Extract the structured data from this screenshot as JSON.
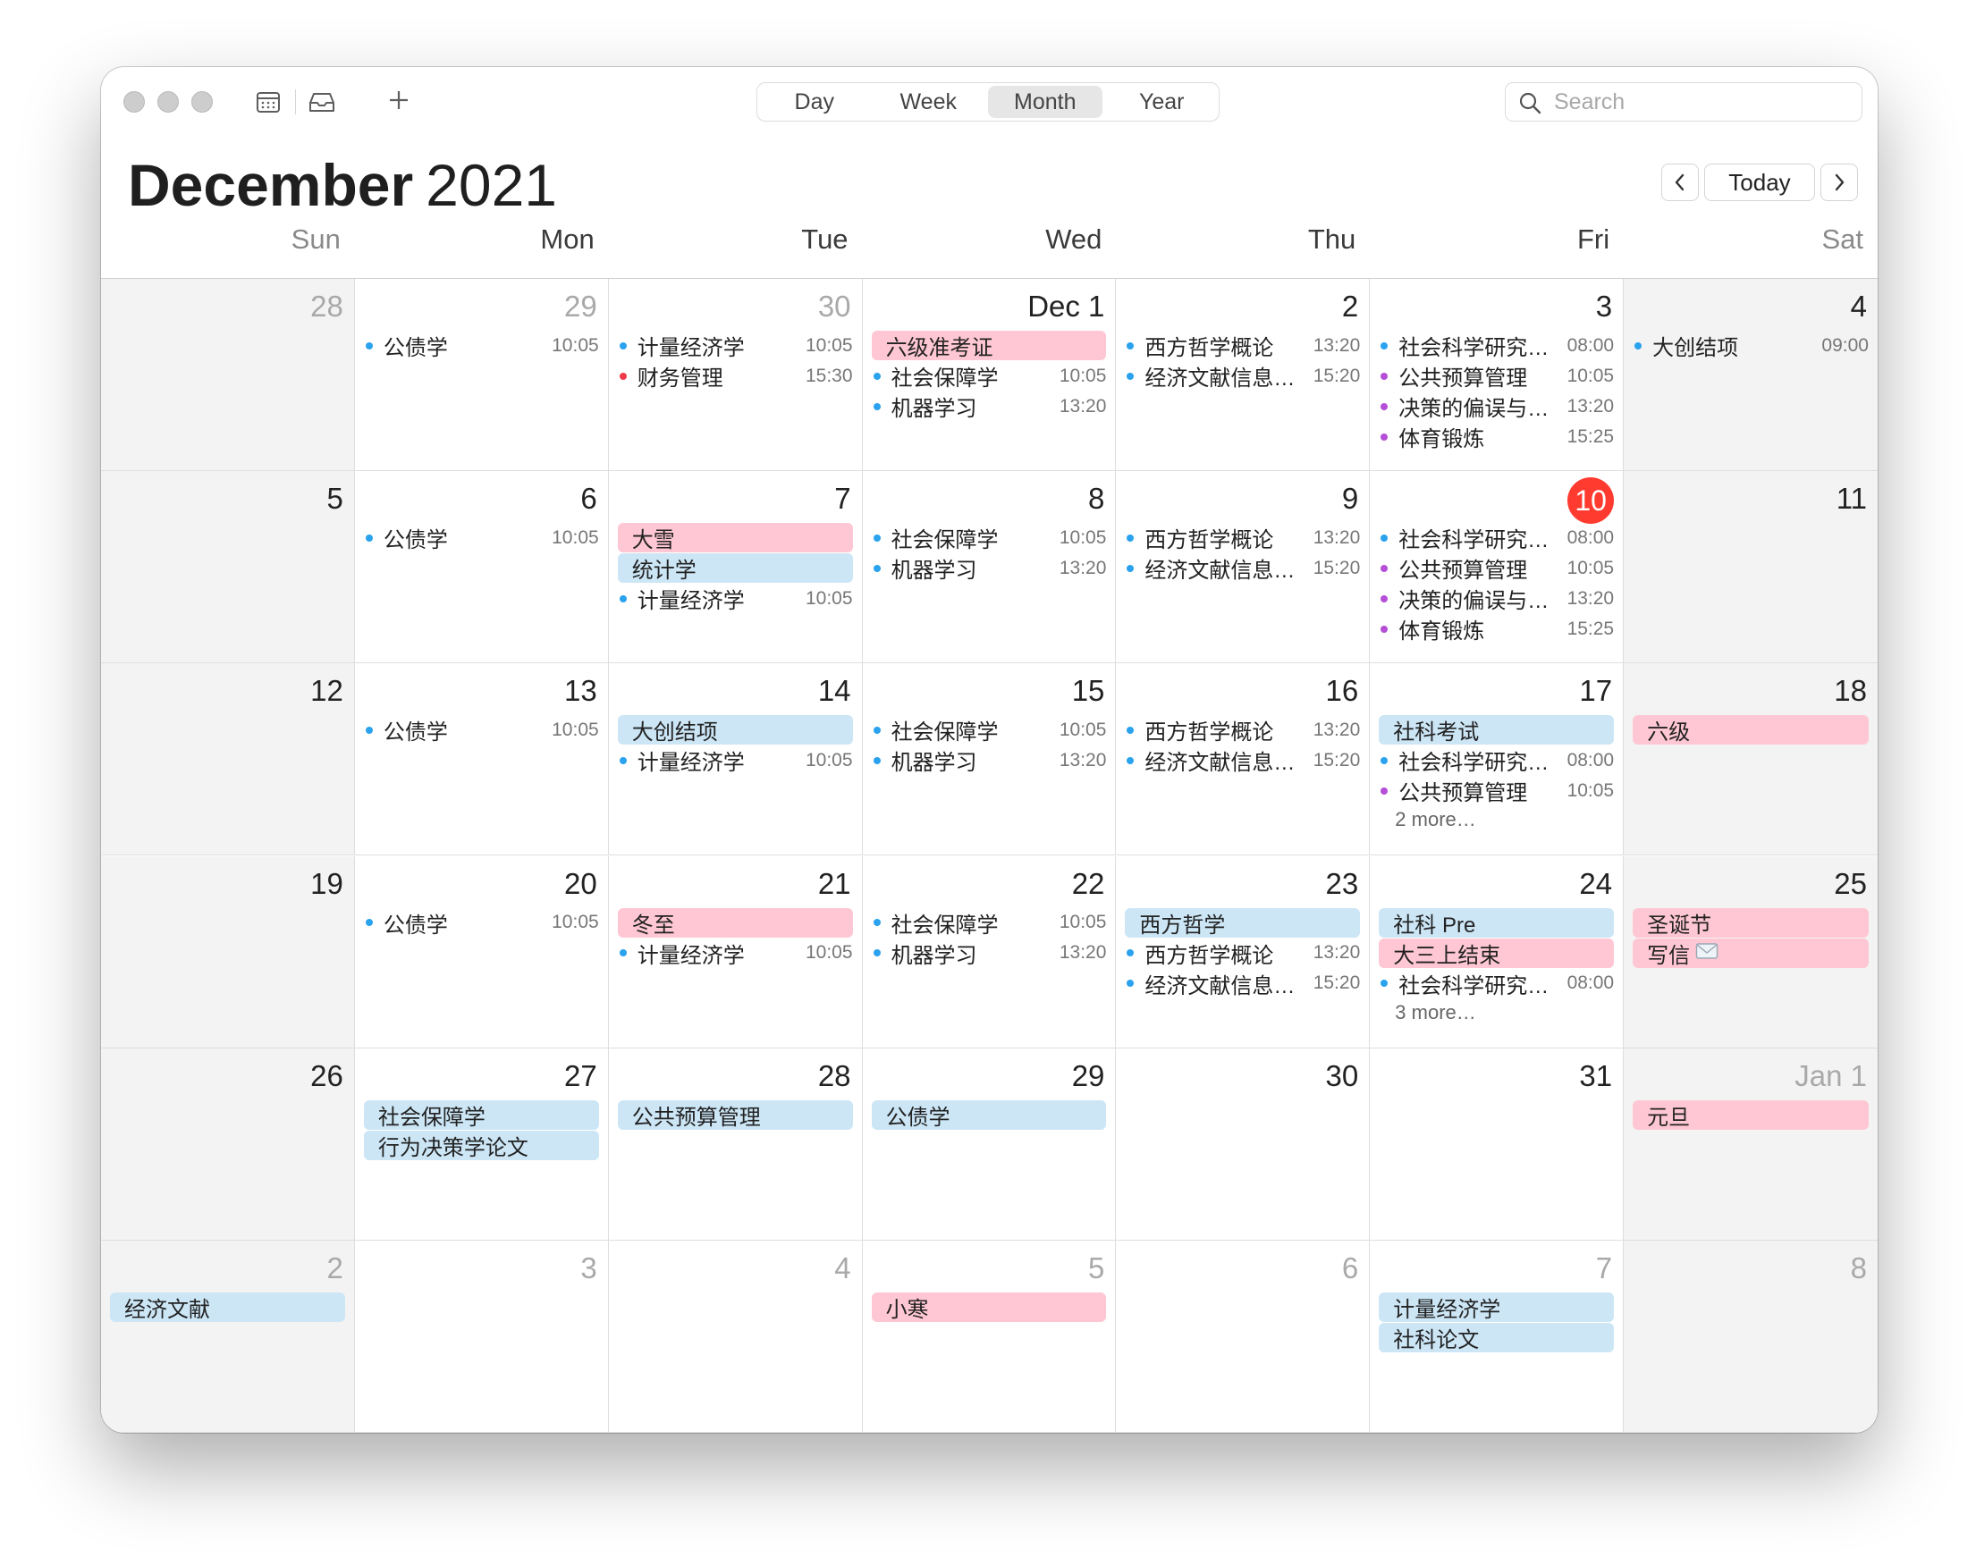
{
  "colors": {
    "blue_dot": "#2aa2ee",
    "red_dot": "#f03a4a",
    "purple_dot": "#b54fd7",
    "allday_pink": "#ffc7d4",
    "allday_blue": "#cce6f6",
    "today_red": "#ff3b30"
  },
  "toolbar": {
    "views": [
      "Day",
      "Week",
      "Month",
      "Year"
    ],
    "active_view": "Month",
    "search_placeholder": "Search",
    "icons": [
      "calendar-list-icon",
      "inbox-icon",
      "plus-icon",
      "search-icon"
    ]
  },
  "header": {
    "month": "December",
    "year": "2021",
    "today_label": "Today"
  },
  "weekdays": [
    "Sun",
    "Mon",
    "Tue",
    "Wed",
    "Thu",
    "Fri",
    "Sat"
  ],
  "weeks": [
    [
      {
        "label": "28",
        "muted": true,
        "events": []
      },
      {
        "label": "29",
        "muted": true,
        "events": [
          {
            "name": "公债学",
            "time": "10:05",
            "dot": "blue"
          }
        ]
      },
      {
        "label": "30",
        "muted": true,
        "events": [
          {
            "name": "计量经济学",
            "time": "10:05",
            "dot": "blue"
          },
          {
            "name": "财务管理",
            "time": "15:30",
            "dot": "red"
          }
        ]
      },
      {
        "label": "Dec 1",
        "events": [
          {
            "name": "六级准考证",
            "allday": "pink"
          },
          {
            "name": "社会保障学",
            "time": "10:05",
            "dot": "blue"
          },
          {
            "name": "机器学习",
            "time": "13:20",
            "dot": "blue"
          }
        ]
      },
      {
        "label": "2",
        "events": [
          {
            "name": "西方哲学概论",
            "time": "13:20",
            "dot": "blue"
          },
          {
            "name": "经济文献信息…",
            "time": "15:20",
            "dot": "blue"
          }
        ]
      },
      {
        "label": "3",
        "events": [
          {
            "name": "社会科学研究…",
            "time": "08:00",
            "dot": "blue"
          },
          {
            "name": "公共预算管理",
            "time": "10:05",
            "dot": "purple"
          },
          {
            "name": "决策的偏误与…",
            "time": "13:20",
            "dot": "purple"
          },
          {
            "name": "体育锻炼",
            "time": "15:25",
            "dot": "purple"
          }
        ]
      },
      {
        "label": "4",
        "events": [
          {
            "name": "大创结项",
            "time": "09:00",
            "dot": "blue"
          }
        ]
      }
    ],
    [
      {
        "label": "5",
        "events": []
      },
      {
        "label": "6",
        "events": [
          {
            "name": "公债学",
            "time": "10:05",
            "dot": "blue"
          }
        ]
      },
      {
        "label": "7",
        "events": [
          {
            "name": "大雪",
            "allday": "pink"
          },
          {
            "name": "统计学",
            "allday": "blue"
          },
          {
            "name": "计量经济学",
            "time": "10:05",
            "dot": "blue"
          }
        ]
      },
      {
        "label": "8",
        "events": [
          {
            "name": "社会保障学",
            "time": "10:05",
            "dot": "blue"
          },
          {
            "name": "机器学习",
            "time": "13:20",
            "dot": "blue"
          }
        ]
      },
      {
        "label": "9",
        "events": [
          {
            "name": "西方哲学概论",
            "time": "13:20",
            "dot": "blue"
          },
          {
            "name": "经济文献信息…",
            "time": "15:20",
            "dot": "blue"
          }
        ]
      },
      {
        "label": "10",
        "today": true,
        "events": [
          {
            "name": "社会科学研究…",
            "time": "08:00",
            "dot": "blue"
          },
          {
            "name": "公共预算管理",
            "time": "10:05",
            "dot": "purple"
          },
          {
            "name": "决策的偏误与…",
            "time": "13:20",
            "dot": "purple"
          },
          {
            "name": "体育锻炼",
            "time": "15:25",
            "dot": "purple"
          }
        ]
      },
      {
        "label": "11",
        "events": []
      }
    ],
    [
      {
        "label": "12",
        "events": []
      },
      {
        "label": "13",
        "events": [
          {
            "name": "公债学",
            "time": "10:05",
            "dot": "blue"
          }
        ]
      },
      {
        "label": "14",
        "events": [
          {
            "name": "大创结项",
            "allday": "blue"
          },
          {
            "name": "计量经济学",
            "time": "10:05",
            "dot": "blue"
          }
        ]
      },
      {
        "label": "15",
        "events": [
          {
            "name": "社会保障学",
            "time": "10:05",
            "dot": "blue"
          },
          {
            "name": "机器学习",
            "time": "13:20",
            "dot": "blue"
          }
        ]
      },
      {
        "label": "16",
        "events": [
          {
            "name": "西方哲学概论",
            "time": "13:20",
            "dot": "blue"
          },
          {
            "name": "经济文献信息…",
            "time": "15:20",
            "dot": "blue"
          }
        ]
      },
      {
        "label": "17",
        "more": "2 more…",
        "events": [
          {
            "name": "社科考试",
            "allday": "blue"
          },
          {
            "name": "社会科学研究…",
            "time": "08:00",
            "dot": "blue"
          },
          {
            "name": "公共预算管理",
            "time": "10:05",
            "dot": "purple"
          }
        ]
      },
      {
        "label": "18",
        "events": [
          {
            "name": "六级",
            "allday": "pink"
          }
        ]
      }
    ],
    [
      {
        "label": "19",
        "events": []
      },
      {
        "label": "20",
        "events": [
          {
            "name": "公债学",
            "time": "10:05",
            "dot": "blue"
          }
        ]
      },
      {
        "label": "21",
        "events": [
          {
            "name": "冬至",
            "allday": "pink"
          },
          {
            "name": "计量经济学",
            "time": "10:05",
            "dot": "blue"
          }
        ]
      },
      {
        "label": "22",
        "events": [
          {
            "name": "社会保障学",
            "time": "10:05",
            "dot": "blue"
          },
          {
            "name": "机器学习",
            "time": "13:20",
            "dot": "blue"
          }
        ]
      },
      {
        "label": "23",
        "events": [
          {
            "name": "西方哲学",
            "allday": "blue"
          },
          {
            "name": "西方哲学概论",
            "time": "13:20",
            "dot": "blue"
          },
          {
            "name": "经济文献信息…",
            "time": "15:20",
            "dot": "blue"
          }
        ]
      },
      {
        "label": "24",
        "more": "3 more…",
        "events": [
          {
            "name": "社科 Pre",
            "allday": "blue"
          },
          {
            "name": "大三上结束",
            "allday": "pink"
          },
          {
            "name": "社会科学研究…",
            "time": "08:00",
            "dot": "blue"
          }
        ]
      },
      {
        "label": "25",
        "events": [
          {
            "name": "圣诞节",
            "allday": "pink"
          },
          {
            "name": "写信",
            "allday": "pink",
            "icon": "envelope-icon"
          }
        ]
      }
    ],
    [
      {
        "label": "26",
        "events": []
      },
      {
        "label": "27",
        "events": [
          {
            "name": "社会保障学",
            "allday": "blue"
          },
          {
            "name": "行为决策学论文",
            "allday": "blue"
          }
        ]
      },
      {
        "label": "28",
        "events": [
          {
            "name": "公共预算管理",
            "allday": "blue"
          }
        ]
      },
      {
        "label": "29",
        "events": [
          {
            "name": "公债学",
            "allday": "blue"
          }
        ]
      },
      {
        "label": "30",
        "events": []
      },
      {
        "label": "31",
        "events": []
      },
      {
        "label": "Jan 1",
        "muted": true,
        "events": [
          {
            "name": "元旦",
            "allday": "pink"
          }
        ]
      }
    ],
    [
      {
        "label": "2",
        "muted": true,
        "events": [
          {
            "name": "经济文献",
            "allday": "blue"
          }
        ]
      },
      {
        "label": "3",
        "muted": true,
        "events": []
      },
      {
        "label": "4",
        "muted": true,
        "events": []
      },
      {
        "label": "5",
        "muted": true,
        "events": [
          {
            "name": "小寒",
            "allday": "pink"
          }
        ]
      },
      {
        "label": "6",
        "muted": true,
        "events": []
      },
      {
        "label": "7",
        "muted": true,
        "events": [
          {
            "name": "计量经济学",
            "allday": "blue"
          },
          {
            "name": "社科论文",
            "allday": "blue"
          }
        ]
      },
      {
        "label": "8",
        "muted": true,
        "events": []
      }
    ]
  ]
}
